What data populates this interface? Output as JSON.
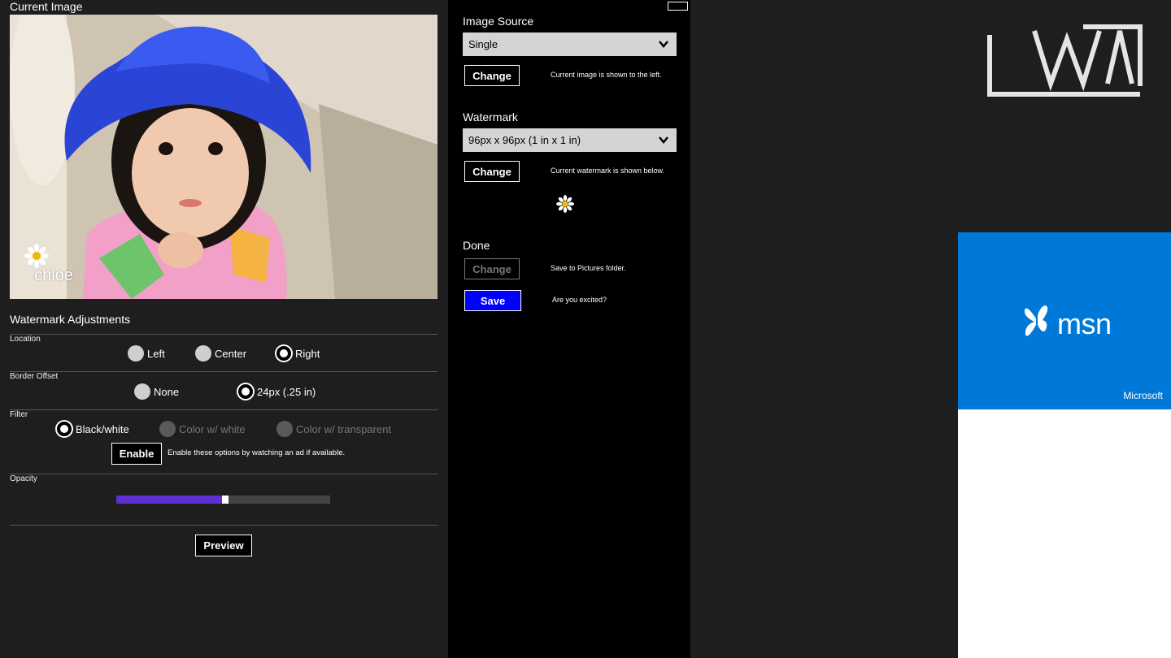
{
  "left": {
    "current_image_title": "Current Image",
    "watermark_text": "chloe",
    "adjustments_title": "Watermark Adjustments",
    "location": {
      "label": "Location",
      "options": [
        "Left",
        "Center",
        "Right"
      ],
      "selected": "Right"
    },
    "border_offset": {
      "label": "Border Offset",
      "options": [
        "None",
        "24px (.25 in)"
      ],
      "selected": "24px (.25 in)"
    },
    "filter": {
      "label": "Filter",
      "options": [
        "Black/white",
        "Color w/ white",
        "Color w/ transparent"
      ],
      "selected": "Black/white",
      "enable_button": "Enable",
      "enable_note": "Enable these options by watching an ad if available."
    },
    "opacity": {
      "label": "Opacity",
      "value": 0.5
    },
    "preview_button": "Preview"
  },
  "middle": {
    "image_source": {
      "label": "Image Source",
      "value": "Single",
      "change_button": "Change",
      "note": "Current image is shown to the left."
    },
    "watermark": {
      "label": "Watermark",
      "value": "96px x 96px (1 in x 1 in)",
      "change_button": "Change",
      "note": "Current watermark is shown below."
    },
    "done": {
      "label": "Done",
      "change_button": "Change",
      "change_note": "Save to Pictures folder.",
      "save_button": "Save",
      "save_note": "Are you excited?"
    }
  },
  "ad": {
    "brand": "msn",
    "company": "Microsoft",
    "color": "#0078d7"
  },
  "colors": {
    "slider_fill": "#5b2fd0",
    "save_button": "#0000ff"
  }
}
